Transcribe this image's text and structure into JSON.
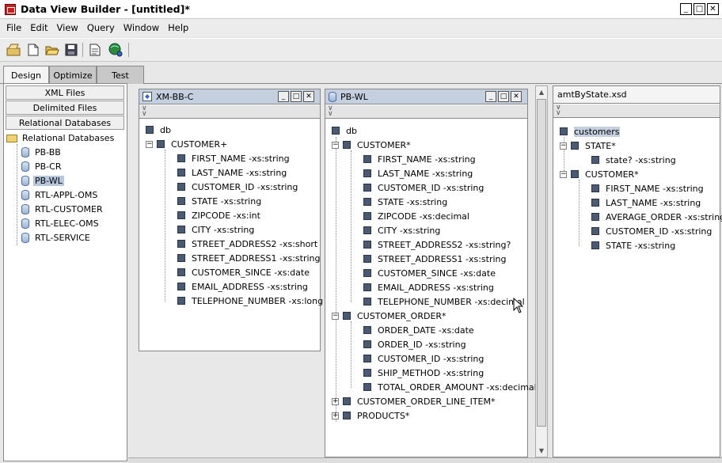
{
  "window": {
    "title": "Data View Builder - [untitled]*"
  },
  "menu": [
    "File",
    "Edit",
    "View",
    "Query",
    "Window",
    "Help"
  ],
  "toolbar_icons": [
    "new-project-icon",
    "new-file-icon",
    "open-folder-icon",
    "save-icon",
    "document-icon",
    "globe-icon"
  ],
  "tabs": [
    "Design",
    "Optimize",
    "Test"
  ],
  "active_tab": "Design",
  "sources": {
    "categories": [
      "XML Files",
      "Delimited Files",
      "Relational Databases"
    ],
    "tree_root": "Relational Databases",
    "databases": [
      "PB-BB",
      "PB-CR",
      "PB-WL",
      "RTL-APPL-OMS",
      "RTL-CUSTOMER",
      "RTL-ELEC-OMS",
      "RTL-SERVICE"
    ],
    "selected": "PB-WL"
  },
  "panel1": {
    "title": "XM-BB-C",
    "root": "db",
    "element": "CUSTOMER+",
    "fields": [
      "FIRST_NAME -xs:string",
      "LAST_NAME -xs:string",
      "CUSTOMER_ID -xs:string",
      "STATE -xs:string",
      "ZIPCODE -xs:int",
      "CITY -xs:string",
      "STREET_ADDRESS2 -xs:short",
      "STREET_ADDRESS1 -xs:string",
      "CUSTOMER_SINCE -xs:date",
      "EMAIL_ADDRESS -xs:string",
      "TELEPHONE_NUMBER -xs:long"
    ]
  },
  "panel2": {
    "title": "PB-WL",
    "root": "db",
    "customer": "CUSTOMER*",
    "customer_fields": [
      "FIRST_NAME -xs:string",
      "LAST_NAME -xs:string",
      "CUSTOMER_ID -xs:string",
      "STATE -xs:string",
      "ZIPCODE -xs:decimal",
      "CITY -xs:string",
      "STREET_ADDRESS2 -xs:string?",
      "STREET_ADDRESS1 -xs:string",
      "CUSTOMER_SINCE -xs:date",
      "EMAIL_ADDRESS -xs:string",
      "TELEPHONE_NUMBER -xs:decimal"
    ],
    "order": "CUSTOMER_ORDER*",
    "order_fields": [
      "ORDER_DATE -xs:date",
      "ORDER_ID -xs:string",
      "CUSTOMER_ID -xs:string",
      "SHIP_METHOD -xs:string",
      "TOTAL_ORDER_AMOUNT -xs:decimal"
    ],
    "line_item": "CUSTOMER_ORDER_LINE_ITEM*",
    "products": "PRODUCTS*"
  },
  "panel3": {
    "title": "amtByState.xsd",
    "root": "customers",
    "state": "STATE*",
    "state_fields": [
      "state? -xs:string"
    ],
    "customer": "CUSTOMER*",
    "customer_fields": [
      "FIRST_NAME -xs:string",
      "LAST_NAME -xs:string",
      "AVERAGE_ORDER -xs:string",
      "CUSTOMER_ID -xs:string",
      "STATE -xs:string"
    ]
  }
}
